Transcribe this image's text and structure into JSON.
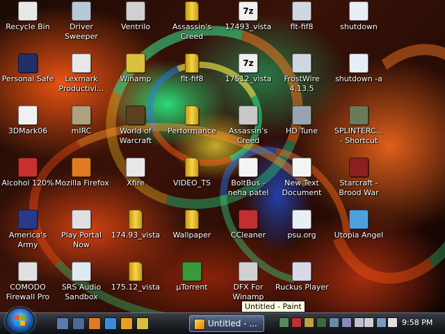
{
  "desktop": {
    "icons": [
      {
        "name": "desktop-icon-recycle-bin",
        "glyph_name": "recycle-bin-icon",
        "label": "Recycle Bin",
        "color": "#e8e8e8"
      },
      {
        "name": "desktop-icon-driver-sweeper",
        "glyph_name": "driver-sweeper-icon",
        "label": "Driver\nSweeper",
        "color": "#b8c8d8"
      },
      {
        "name": "desktop-icon-ventrilo",
        "glyph_name": "ventrilo-icon",
        "label": "Ventrilo",
        "color": "#d0d0d0"
      },
      {
        "name": "desktop-icon-assassins-creed-1",
        "glyph_name": "folder-icon",
        "label": "Assassin's\nCreed",
        "color": "#f2c21a"
      },
      {
        "name": "desktop-icon-17493-vista",
        "glyph_name": "7z-archive-icon",
        "label": "17493_vista",
        "color": "#e6e6e6",
        "text": "7z"
      },
      {
        "name": "desktop-icon-flt-fif8-1",
        "glyph_name": "flt-file-icon",
        "label": "flt-fif8",
        "color": "#cfd8e0"
      },
      {
        "name": "desktop-icon-shutdown",
        "glyph_name": "shutdown-icon",
        "label": "shutdown",
        "color": "#e8eef6"
      },
      {
        "name": "desktop-icon-personal-safe",
        "glyph_name": "safe-icon",
        "label": "Personal Safe",
        "color": "#22306a"
      },
      {
        "name": "desktop-icon-lexmark",
        "glyph_name": "lexmark-icon",
        "label": "Lexmark\nProductivi...",
        "color": "#e8e8e8"
      },
      {
        "name": "desktop-icon-winamp-1",
        "glyph_name": "winamp-icon",
        "label": "Winamp",
        "color": "#d8c040"
      },
      {
        "name": "desktop-icon-flt-fif8-2",
        "glyph_name": "folder-icon",
        "label": "flt-fif8",
        "color": "#f2c21a"
      },
      {
        "name": "desktop-icon-17512-vista-1",
        "glyph_name": "7z-archive-icon",
        "label": "17512_vista",
        "color": "#e6e6e6",
        "text": "7z"
      },
      {
        "name": "desktop-icon-frostwire",
        "glyph_name": "frostwire-icon",
        "label": "FrostWire\n4.13.5",
        "color": "#cfd8e0"
      },
      {
        "name": "desktop-icon-shutdown-a",
        "glyph_name": "shutdown-icon",
        "label": "shutdown -a",
        "color": "#e8eef6"
      },
      {
        "name": "desktop-icon-3dmark06",
        "glyph_name": "3dmark-icon",
        "label": "3DMark06",
        "color": "#f0f0f0"
      },
      {
        "name": "desktop-icon-mirc",
        "glyph_name": "mirc-icon",
        "label": "mIRC",
        "color": "#b0a080"
      },
      {
        "name": "desktop-icon-world-of-warcraft",
        "glyph_name": "wow-icon",
        "label": "World of\nWarcraft",
        "color": "#5a4020"
      },
      {
        "name": "desktop-icon-performance",
        "glyph_name": "folder-icon",
        "label": "Performance",
        "color": "#f2c21a"
      },
      {
        "name": "desktop-icon-assassins-creed-2",
        "glyph_name": "assassins-creed-icon",
        "label": "Assassin's\nCreed",
        "color": "#c8c8c8"
      },
      {
        "name": "desktop-icon-hd-tune",
        "glyph_name": "hd-tune-icon",
        "label": "HD Tune",
        "color": "#9aa4b0"
      },
      {
        "name": "desktop-icon-splinter-cell",
        "glyph_name": "splinter-cell-icon",
        "label": "SPLINTERC...\n- Shortcut",
        "color": "#6a7a5a"
      },
      {
        "name": "desktop-icon-alcohol-120",
        "glyph_name": "alcohol-icon",
        "label": "Alcohol 120%",
        "color": "#c83030"
      },
      {
        "name": "desktop-icon-mozilla-firefox",
        "glyph_name": "firefox-icon",
        "label": "Mozilla Firefox",
        "color": "#e07a20"
      },
      {
        "name": "desktop-icon-xfire",
        "glyph_name": "xfire-icon",
        "label": "Xfire",
        "color": "#e8e8e8"
      },
      {
        "name": "desktop-icon-video-ts",
        "glyph_name": "folder-icon",
        "label": "VIDEO_TS",
        "color": "#f2c21a"
      },
      {
        "name": "desktop-icon-boltbus",
        "glyph_name": "document-icon",
        "label": "BoltBus -\nneha patel",
        "color": "#f4f4f4"
      },
      {
        "name": "desktop-icon-new-text-document",
        "glyph_name": "text-document-icon",
        "label": "New Text\nDocument",
        "color": "#f4f4f4"
      },
      {
        "name": "desktop-icon-starcraft",
        "glyph_name": "starcraft-icon",
        "label": "Starcraft -\nBrood War",
        "color": "#8a2020"
      },
      {
        "name": "desktop-icon-americas-army",
        "glyph_name": "americas-army-icon",
        "label": "America's\nArmy",
        "color": "#2a3a8a"
      },
      {
        "name": "desktop-icon-play-portal",
        "glyph_name": "play-portal-icon",
        "label": "Play Portal\nNow",
        "color": "#e0e0e0"
      },
      {
        "name": "desktop-icon-17493-vista-folder",
        "glyph_name": "folder-icon",
        "label": "174.93_vista",
        "color": "#f2c21a"
      },
      {
        "name": "desktop-icon-wallpaper",
        "glyph_name": "folder-icon",
        "label": "Wallpaper",
        "color": "#f2c21a"
      },
      {
        "name": "desktop-icon-ccleaner",
        "glyph_name": "ccleaner-icon",
        "label": "CCleaner",
        "color": "#c03030"
      },
      {
        "name": "desktop-icon-psu-org",
        "glyph_name": "document-icon",
        "label": "psu.org",
        "color": "#e8eef6"
      },
      {
        "name": "desktop-icon-utopia-angel",
        "glyph_name": "utopia-angel-icon",
        "label": "Utopia Angel",
        "color": "#50a0e0"
      },
      {
        "name": "desktop-icon-comodo-firewall",
        "glyph_name": "comodo-icon",
        "label": "COMODO\nFirewall Pro",
        "color": "#e0e0e0"
      },
      {
        "name": "desktop-icon-srs-audio-sandbox",
        "glyph_name": "srs-audio-icon",
        "label": "SRS Audio\nSandbox",
        "color": "#e0e8f0"
      },
      {
        "name": "desktop-icon-17512-vista-folder",
        "glyph_name": "folder-icon",
        "label": "175.12_vista",
        "color": "#f2c21a"
      },
      {
        "name": "desktop-icon-utorrent",
        "glyph_name": "utorrent-icon",
        "label": "µTorrent",
        "color": "#3a9a3a"
      },
      {
        "name": "desktop-icon-dfx-winamp",
        "glyph_name": "dfx-icon",
        "label": "DFX For\nWinamp",
        "color": "#d0d0d0"
      },
      {
        "name": "desktop-icon-ruckus-player",
        "glyph_name": "ruckus-player-icon",
        "label": "Ruckus Player",
        "color": "#d8d8e8"
      }
    ],
    "tooltip": "Untitled - Paint"
  },
  "taskbar": {
    "start_button": "start-orb",
    "quick_launch": [
      {
        "name": "quicklaunch-show-desktop",
        "icon": "show-desktop-icon",
        "color": "#5a7aa8"
      },
      {
        "name": "quicklaunch-switch-windows",
        "icon": "switch-windows-icon",
        "color": "#4a6a98"
      },
      {
        "name": "quicklaunch-firefox",
        "icon": "firefox-icon",
        "color": "#e07a20"
      },
      {
        "name": "quicklaunch-ie",
        "icon": "internet-explorer-icon",
        "color": "#3a8ad8"
      },
      {
        "name": "quicklaunch-media-player",
        "icon": "media-player-icon",
        "color": "#e8a020"
      },
      {
        "name": "quicklaunch-winamp",
        "icon": "winamp-icon",
        "color": "#d8c040"
      }
    ],
    "task_button_label": "Untitled - ...",
    "tray": [
      {
        "name": "tray-icon-1",
        "icon": "monitor-tray-icon",
        "color": "#5a8a5a"
      },
      {
        "name": "tray-icon-2",
        "icon": "security-tray-icon",
        "color": "#c03030"
      },
      {
        "name": "tray-icon-3",
        "icon": "ghz-tray-icon",
        "color": "#c0a040"
      },
      {
        "name": "tray-icon-4",
        "icon": "graph-tray-icon",
        "color": "#3a6a3a"
      },
      {
        "name": "tray-icon-5",
        "icon": "network-tray-icon",
        "color": "#6a8aa8"
      },
      {
        "name": "tray-icon-6",
        "icon": "chat-tray-icon",
        "color": "#8a8ab8"
      },
      {
        "name": "tray-icon-7",
        "icon": "safe-tray-icon",
        "color": "#c0c0d0"
      },
      {
        "name": "tray-icon-8",
        "icon": "device-tray-icon",
        "color": "#d0d0d0"
      },
      {
        "name": "tray-icon-9",
        "icon": "network-tray-icon",
        "color": "#7a9ac0"
      },
      {
        "name": "tray-icon-10",
        "icon": "volume-icon",
        "color": "#e0e0e0"
      }
    ],
    "clock": "9:58 PM"
  }
}
